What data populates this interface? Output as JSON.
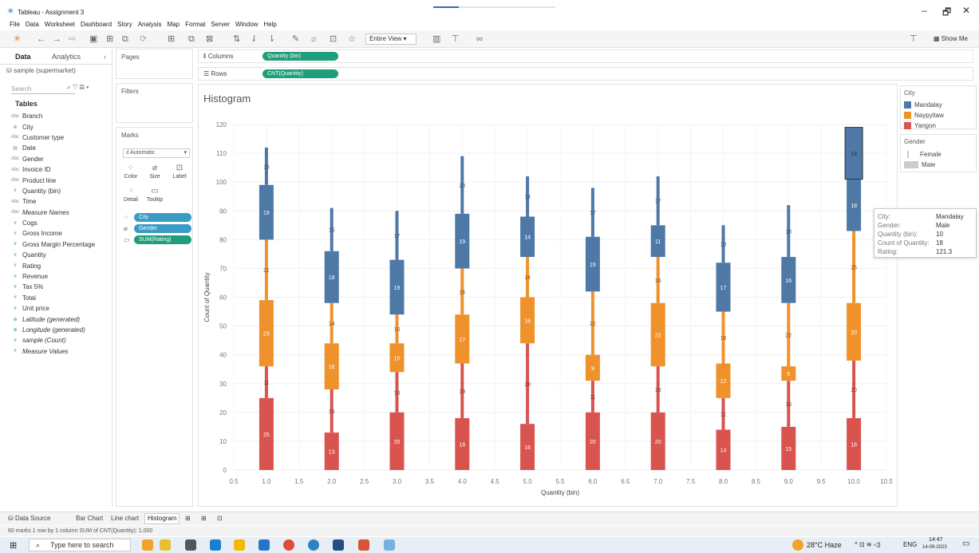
{
  "window": {
    "title": "Tableau - Assignment 3",
    "minimize": "–",
    "restore": "🗗",
    "close": "✕"
  },
  "menu": [
    "File",
    "Data",
    "Worksheet",
    "Dashboard",
    "Story",
    "Analysis",
    "Map",
    "Format",
    "Server",
    "Window",
    "Help"
  ],
  "toolbar": {
    "view_select": "Entire View",
    "show_me": "Show Me"
  },
  "datapane": {
    "tab_data": "Data",
    "tab_analytics": "Analytics",
    "source": "sample (supermarket)",
    "search_placeholder": "Search",
    "tables_label": "Tables",
    "fields": [
      {
        "icon": "Abc",
        "name": "Branch",
        "kind": "dim"
      },
      {
        "icon": "⊕",
        "name": "City",
        "kind": "dim"
      },
      {
        "icon": "Abc",
        "name": "Customer type",
        "kind": "dim"
      },
      {
        "icon": "▤",
        "name": "Date",
        "kind": "dim"
      },
      {
        "icon": "Abc",
        "name": "Gender",
        "kind": "dim"
      },
      {
        "icon": "Abc",
        "name": "Invoice ID",
        "kind": "dim"
      },
      {
        "icon": "Abc",
        "name": "Product line",
        "kind": "dim"
      },
      {
        "icon": "ıl",
        "name": "Quantity (bin)",
        "kind": "dim"
      },
      {
        "icon": "Abc",
        "name": "Time",
        "kind": "dim"
      },
      {
        "icon": "Abc",
        "name": "Measure Names",
        "kind": "dim",
        "italic": true
      },
      {
        "icon": "#",
        "name": "Cogs",
        "kind": "measure"
      },
      {
        "icon": "#",
        "name": "Gross Income",
        "kind": "measure"
      },
      {
        "icon": "#",
        "name": "Gross Margin Percentage",
        "kind": "measure"
      },
      {
        "icon": "#",
        "name": "Quantity",
        "kind": "measure"
      },
      {
        "icon": "#",
        "name": "Rating",
        "kind": "measure"
      },
      {
        "icon": "#",
        "name": "Revenue",
        "kind": "measure"
      },
      {
        "icon": "#",
        "name": "Tax 5%",
        "kind": "measure"
      },
      {
        "icon": "#",
        "name": "Total",
        "kind": "measure"
      },
      {
        "icon": "#",
        "name": "Unit price",
        "kind": "measure"
      },
      {
        "icon": "⊕",
        "name": "Latitude (generated)",
        "kind": "measure",
        "italic": true
      },
      {
        "icon": "⊕",
        "name": "Longitude (generated)",
        "kind": "measure",
        "italic": true
      },
      {
        "icon": "#",
        "name": "sample (Count)",
        "kind": "measure",
        "italic": true
      },
      {
        "icon": "#",
        "name": "Measure Values",
        "kind": "measure",
        "italic": true
      }
    ]
  },
  "shelves": {
    "pages": "Pages",
    "filters": "Filters",
    "marks": "Marks",
    "mark_type": "Automatic",
    "buttons": {
      "color": "Color",
      "size": "Size",
      "label": "Label",
      "detail": "Detail",
      "tooltip": "Tooltip"
    },
    "mark_pills": [
      "City",
      "Gender",
      "SUM(Rating)"
    ],
    "columns_label": "Columns",
    "columns_pill": "Quantity (bin)",
    "rows_label": "Rows",
    "rows_pill": "CNT(Quantity)"
  },
  "sheet": {
    "title": "Histogram"
  },
  "chart_data": {
    "type": "bar",
    "title": "Histogram",
    "xlabel": "Quantity (bin)",
    "ylabel": "Count of Quantity",
    "x_ticks": [
      "0.5",
      "1.0",
      "1.5",
      "2.0",
      "2.5",
      "3.0",
      "3.5",
      "4.0",
      "4.5",
      "5.0",
      "5.5",
      "6.0",
      "6.5",
      "7.0",
      "7.5",
      "8.0",
      "8.5",
      "9.0",
      "9.5",
      "10.0",
      "10.5"
    ],
    "y_ticks": [
      "0",
      "10",
      "20",
      "30",
      "40",
      "50",
      "60",
      "70",
      "80",
      "90",
      "100",
      "110",
      "120"
    ],
    "xlim": [
      0.5,
      10.5
    ],
    "ylim": [
      0,
      120
    ],
    "grid": true,
    "stacked": true,
    "categories": [
      1,
      2,
      3,
      4,
      5,
      6,
      7,
      8,
      9,
      10
    ],
    "series": [
      {
        "name": "Yangon",
        "color": "#d9534f",
        "female": [
          25,
          13,
          20,
          18,
          16,
          20,
          20,
          14,
          15,
          18
        ],
        "male": [
          11,
          15,
          14,
          19,
          28,
          11,
          16,
          11,
          16,
          20
        ]
      },
      {
        "name": "Naypyitaw",
        "color": "#f0922b",
        "female": [
          23,
          16,
          10,
          17,
          16,
          9,
          22,
          12,
          5,
          20
        ],
        "male": [
          21,
          14,
          10,
          16,
          14,
          22,
          16,
          18,
          22,
          25
        ]
      },
      {
        "name": "Mandalay",
        "color": "#4e79a7",
        "female": [
          19,
          18,
          19,
          19,
          14,
          19,
          11,
          17,
          16,
          18
        ],
        "male": [
          13,
          15,
          17,
          20,
          14,
          17,
          17,
          13,
          18,
          18
        ]
      }
    ]
  },
  "legends": {
    "city_title": "City",
    "cities": [
      {
        "name": "Mandalay",
        "color": "#4e79a7"
      },
      {
        "name": "Naypyitaw",
        "color": "#f0922b"
      },
      {
        "name": "Yangon",
        "color": "#d9534f"
      }
    ],
    "gender_title": "Gender",
    "genders": [
      "Female",
      "Male"
    ]
  },
  "tooltip": {
    "rows": [
      {
        "k": "City:",
        "v": "Mandalay"
      },
      {
        "k": "Gender:",
        "v": "Male"
      },
      {
        "k": "Quantity (bin):",
        "v": "10"
      },
      {
        "k": "Count of Quantity:",
        "v": "18"
      },
      {
        "k": "Rating:",
        "v": "121.3"
      }
    ]
  },
  "tabs": {
    "data_source": "Data Source",
    "sheets": [
      "Bar Chart",
      "Line chart",
      "Histogram"
    ]
  },
  "status": {
    "text": "60 marks    1 row by 1 column    SUM of CNT(Quantity): 1,000"
  },
  "taskbar": {
    "search_placeholder": "Type here to search",
    "weather": "28°C  Haze",
    "lang": "ENG",
    "time": "14:47",
    "date": "14-09-2023"
  }
}
